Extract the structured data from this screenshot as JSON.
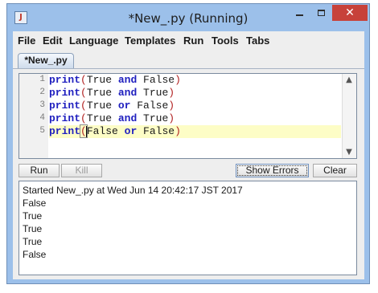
{
  "window": {
    "title": "*New_.py (Running)"
  },
  "menu": [
    "File",
    "Edit",
    "Language",
    "Templates",
    "Run",
    "Tools",
    "Tabs"
  ],
  "tab": {
    "label": "*New_.py"
  },
  "editor": {
    "lines": [
      {
        "number": "1",
        "tokens": [
          {
            "t": "kw",
            "v": "print"
          },
          {
            "t": "paren",
            "v": "("
          },
          {
            "t": "txt",
            "v": "True "
          },
          {
            "t": "kw",
            "v": "and"
          },
          {
            "t": "txt",
            "v": " False"
          },
          {
            "t": "paren",
            "v": ")"
          }
        ]
      },
      {
        "number": "2",
        "tokens": [
          {
            "t": "kw",
            "v": "print"
          },
          {
            "t": "paren",
            "v": "("
          },
          {
            "t": "txt",
            "v": "True "
          },
          {
            "t": "kw",
            "v": "and"
          },
          {
            "t": "txt",
            "v": " True"
          },
          {
            "t": "paren",
            "v": ")"
          }
        ]
      },
      {
        "number": "3",
        "tokens": [
          {
            "t": "kw",
            "v": "print"
          },
          {
            "t": "paren",
            "v": "("
          },
          {
            "t": "txt",
            "v": "True "
          },
          {
            "t": "kw",
            "v": "or"
          },
          {
            "t": "txt",
            "v": " False"
          },
          {
            "t": "paren",
            "v": ")"
          }
        ]
      },
      {
        "number": "4",
        "tokens": [
          {
            "t": "kw",
            "v": "print"
          },
          {
            "t": "paren",
            "v": "("
          },
          {
            "t": "txt",
            "v": "True "
          },
          {
            "t": "kw",
            "v": "and"
          },
          {
            "t": "txt",
            "v": " True"
          },
          {
            "t": "paren",
            "v": ")"
          }
        ]
      },
      {
        "number": "5",
        "tokens": [
          {
            "t": "kw",
            "v": "print"
          },
          {
            "t": "paren",
            "v": "("
          },
          {
            "t": "txt",
            "v": "False "
          },
          {
            "t": "kw",
            "v": "or"
          },
          {
            "t": "txt",
            "v": " False"
          },
          {
            "t": "paren",
            "v": ")"
          }
        ]
      }
    ]
  },
  "toolbar": {
    "run": "Run",
    "kill": "Kill",
    "show_errors": "Show Errors",
    "clear": "Clear"
  },
  "output": {
    "lines": [
      "Started New_.py at Wed Jun 14 20:42:17 JST 2017",
      "False",
      "True",
      "True",
      "True",
      "False"
    ]
  },
  "icons": {
    "app": "app-icon",
    "minimize": "minimize-icon",
    "maximize": "maximize-icon",
    "close": "close-icon",
    "scroll_up": "scroll-up-arrow-icon",
    "scroll_down": "scroll-down-arrow-icon"
  },
  "colors": {
    "window_frame": "#9cc0ea",
    "close_button": "#c7423a",
    "keyword": "#1f1fbf",
    "paren": "#b22222",
    "current_line": "#fdfdc6"
  }
}
